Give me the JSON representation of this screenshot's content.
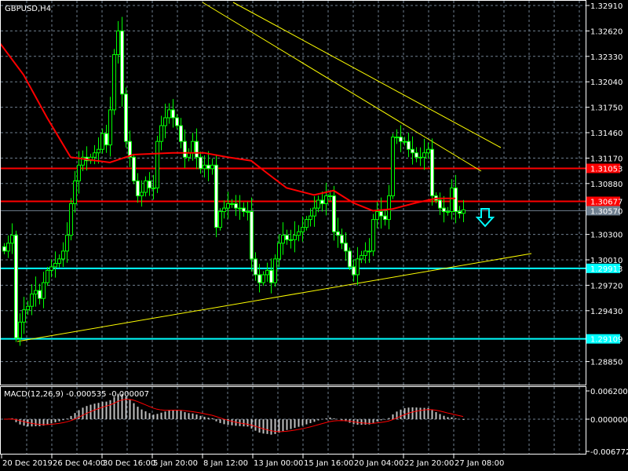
{
  "header": {
    "symbol_label": "GBPUSD,H4"
  },
  "chart_data": {
    "type": "candlestick",
    "title": "GBPUSD,H4",
    "ylim": [
      1.287,
      1.3295
    ],
    "price_ticks": [
      "1.32910",
      "1.32620",
      "1.32330",
      "1.32040",
      "1.31750",
      "1.31460",
      "1.31170",
      "1.30880",
      "1.30300",
      "1.30010",
      "1.29720",
      "1.29430",
      "1.28850"
    ],
    "time_labels": [
      "20 Dec 2019",
      "26 Dec 04:00",
      "30 Dec 16:00",
      "5 Jan 20:00",
      "8 Jan 12:00",
      "13 Jan 00:00",
      "15 Jan 16:00",
      "20 Jan 04:00",
      "22 Jan 20:00",
      "27 Jan 08:00"
    ],
    "closes": [
      1.3011,
      1.302,
      1.3029,
      1.2912,
      1.293,
      1.2944,
      1.2948,
      1.2962,
      1.2966,
      1.2957,
      1.2975,
      1.2989,
      1.2993,
      1.2997,
      1.3002,
      1.3011,
      1.3029,
      1.3065,
      1.3091,
      1.3109,
      1.3118,
      1.3114,
      1.3118,
      1.3123,
      1.3127,
      1.3145,
      1.3132,
      1.3172,
      1.3235,
      1.3262,
      1.319,
      1.3136,
      1.3118,
      1.3091,
      1.3074,
      1.3078,
      1.3091,
      1.3083,
      1.3083,
      1.3136,
      1.3154,
      1.3163,
      1.3172,
      1.3163,
      1.3154,
      1.3136,
      1.3118,
      1.3123,
      1.3136,
      1.3118,
      1.3105,
      1.3109,
      1.3105,
      1.3109,
      1.3038,
      1.3056,
      1.306,
      1.3065,
      1.3065,
      1.306,
      1.306,
      1.3056,
      1.3056,
      1.3002,
      1.2984,
      1.2975,
      1.2984,
      1.2989,
      1.2975,
      1.3002,
      1.302,
      1.3029,
      1.3024,
      1.3024,
      1.3029,
      1.3033,
      1.3038,
      1.3047,
      1.3051,
      1.306,
      1.3069,
      1.3065,
      1.3074,
      1.3074,
      1.3033,
      1.3029,
      1.302,
      1.3011,
      1.2993,
      1.2984,
      1.3002,
      1.3006,
      1.3011,
      1.3011,
      1.3047,
      1.3056,
      1.3051,
      1.3047,
      1.3074,
      1.3141,
      1.3141,
      1.3136,
      1.3136,
      1.3127,
      1.3123,
      1.3118,
      1.3118,
      1.3123,
      1.3127,
      1.3074,
      1.3069,
      1.306,
      1.3056,
      1.3056,
      1.3083,
      1.3056,
      1.3054,
      1.3058
    ],
    "moving_average": [
      [
        -1,
        1.3248
      ],
      [
        5,
        1.3212
      ],
      [
        11,
        1.3163
      ],
      [
        17,
        1.3118
      ],
      [
        27,
        1.3112
      ],
      [
        33,
        1.3121
      ],
      [
        43,
        1.3123
      ],
      [
        51,
        1.3123
      ],
      [
        57,
        1.3118
      ],
      [
        63,
        1.3114
      ],
      [
        67,
        1.31
      ],
      [
        72,
        1.3083
      ],
      [
        79,
        1.3075
      ],
      [
        84,
        1.308
      ],
      [
        89,
        1.3066
      ],
      [
        94,
        1.3057
      ],
      [
        99,
        1.3059
      ],
      [
        105,
        1.3066
      ],
      [
        110,
        1.3071
      ],
      [
        115,
        1.3071
      ]
    ],
    "hlines": [
      {
        "price": 1.31053,
        "label": "1.31053",
        "color": "#ff0000"
      },
      {
        "price": 1.30677,
        "label": "1.30677",
        "color": "#ff0000"
      },
      {
        "price": 1.29913,
        "label": "1.29913",
        "color": "#00ffff"
      },
      {
        "price": 1.29109,
        "label": "1.29109",
        "color": "#00ffff"
      }
    ],
    "current_price": {
      "price": 1.3057,
      "label": "1.30570",
      "color": "#708090"
    },
    "signal": "down-arrow",
    "colors": {
      "bull": "#00ff00",
      "bear": "#ffffff",
      "ma": "#ff0000",
      "trendline": "#ffff00",
      "grid": "#708090"
    }
  },
  "macd": {
    "label": "MACD(12,26,9) -0.000535 -0.000007",
    "ticks": [
      "0.006200",
      "0.000000",
      "-0.006772"
    ],
    "range": [
      -0.006772,
      0.0062
    ]
  }
}
